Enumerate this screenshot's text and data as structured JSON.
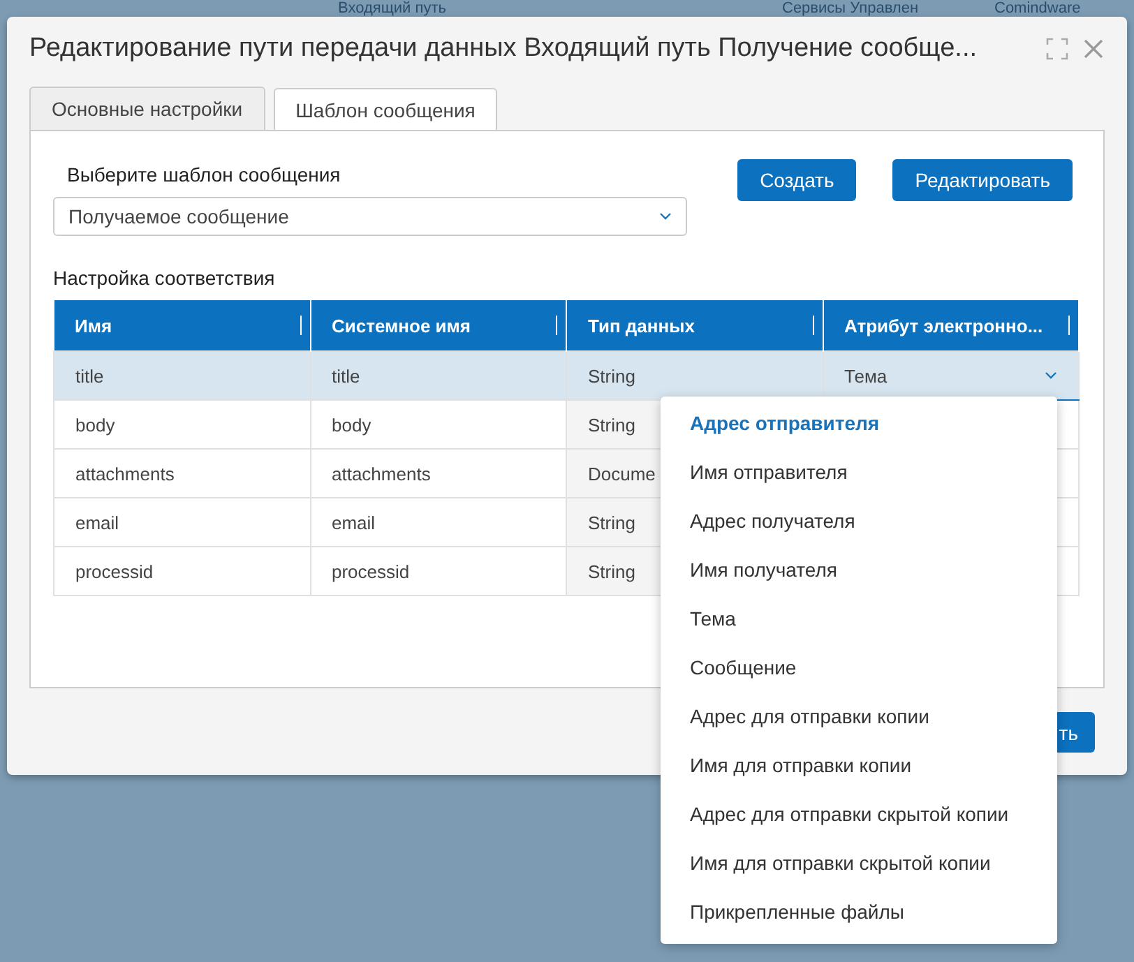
{
  "background_header": [
    "Входящий путь",
    "Сервисы Управлен",
    "Comindware"
  ],
  "dialog": {
    "title": "Редактирование пути передачи данных Входящий путь Получение сообще...",
    "tabs": [
      {
        "label": "Основные настройки",
        "selected": false
      },
      {
        "label": "Шаблон сообщения",
        "selected": true
      }
    ],
    "template_label": "Выберите шаблон сообщения",
    "template_select": {
      "value": "Получаемое сообщение"
    },
    "buttons": [
      "Создать",
      "Редактировать"
    ],
    "mapping_title": "Настройка соответствия",
    "table": {
      "columns": [
        "Имя",
        "Системное имя",
        "Тип данных",
        "Атрибут электронно..."
      ],
      "rows": [
        {
          "cells": [
            "title",
            "title",
            "String",
            "Тема"
          ],
          "selected": true
        },
        {
          "cells": [
            "body",
            "body",
            "String",
            ""
          ],
          "selected": false
        },
        {
          "cells": [
            "attachments",
            "attachments",
            "Docume",
            ""
          ],
          "selected": false
        },
        {
          "cells": [
            "email",
            "email",
            "String",
            ""
          ],
          "selected": false
        },
        {
          "cells": [
            "processid",
            "processid",
            "String",
            ""
          ],
          "selected": false
        }
      ]
    },
    "footer_button": "ть",
    "dropdown": [
      {
        "label": "Адрес отправителя",
        "selected": true
      },
      {
        "label": "Имя отправителя",
        "selected": false
      },
      {
        "label": "Адрес получателя",
        "selected": false
      },
      {
        "label": "Имя получателя",
        "selected": false
      },
      {
        "label": "Тема",
        "selected": false
      },
      {
        "label": "Сообщение",
        "selected": false
      },
      {
        "label": "Адрес для отправки копии",
        "selected": false
      },
      {
        "label": "Имя для отправки копии",
        "selected": false
      },
      {
        "label": "Адрес для отправки скрытой копии",
        "selected": false
      },
      {
        "label": "Имя для отправки скрытой копии",
        "selected": false
      },
      {
        "label": "Прикрепленные файлы",
        "selected": false
      }
    ]
  }
}
